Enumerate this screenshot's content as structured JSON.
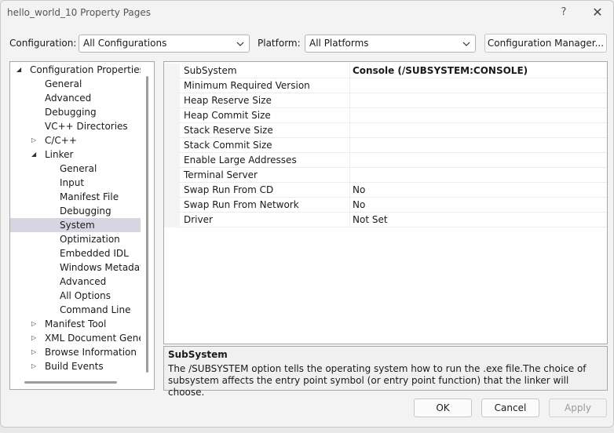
{
  "window": {
    "title": "hello_world_10 Property Pages",
    "help": "?",
    "close": "✕"
  },
  "toolbar": {
    "configuration_label": "Configuration:",
    "configuration_value": "All Configurations",
    "platform_label": "Platform:",
    "platform_value": "All Platforms",
    "config_manager_button": "Configuration Manager..."
  },
  "tree": {
    "items": [
      {
        "label": "Configuration Properties",
        "expander": "◢"
      },
      {
        "label": "General"
      },
      {
        "label": "Advanced"
      },
      {
        "label": "Debugging"
      },
      {
        "label": "VC++ Directories"
      },
      {
        "label": "C/C++",
        "expander": "▷"
      },
      {
        "label": "Linker",
        "expander": "◢"
      },
      {
        "label": "General"
      },
      {
        "label": "Input"
      },
      {
        "label": "Manifest File"
      },
      {
        "label": "Debugging"
      },
      {
        "label": "System",
        "selected": true
      },
      {
        "label": "Optimization"
      },
      {
        "label": "Embedded IDL"
      },
      {
        "label": "Windows Metadata"
      },
      {
        "label": "Advanced"
      },
      {
        "label": "All Options"
      },
      {
        "label": "Command Line"
      },
      {
        "label": "Manifest Tool",
        "expander": "▷"
      },
      {
        "label": "XML Document Genera",
        "expander": "▷"
      },
      {
        "label": "Browse Information",
        "expander": "▷"
      },
      {
        "label": "Build Events",
        "expander": "▷"
      }
    ]
  },
  "properties": [
    {
      "name": "SubSystem",
      "value": "Console (/SUBSYSTEM:CONSOLE)",
      "bold": true
    },
    {
      "name": "Minimum Required Version",
      "value": ""
    },
    {
      "name": "Heap Reserve Size",
      "value": ""
    },
    {
      "name": "Heap Commit Size",
      "value": ""
    },
    {
      "name": "Stack Reserve Size",
      "value": ""
    },
    {
      "name": "Stack Commit Size",
      "value": ""
    },
    {
      "name": "Enable Large Addresses",
      "value": ""
    },
    {
      "name": "Terminal Server",
      "value": ""
    },
    {
      "name": "Swap Run From CD",
      "value": "No"
    },
    {
      "name": "Swap Run From Network",
      "value": "No"
    },
    {
      "name": "Driver",
      "value": "Not Set"
    }
  ],
  "description": {
    "title": "SubSystem",
    "text": "The /SUBSYSTEM option tells the operating system how to run the .exe file.The choice of subsystem affects the entry point symbol (or entry point function) that the linker will choose."
  },
  "buttons": {
    "ok": "OK",
    "cancel": "Cancel",
    "apply": "Apply"
  },
  "colors": {
    "selection": "#d6d6e2",
    "window_bg": "#f3f3f3"
  }
}
